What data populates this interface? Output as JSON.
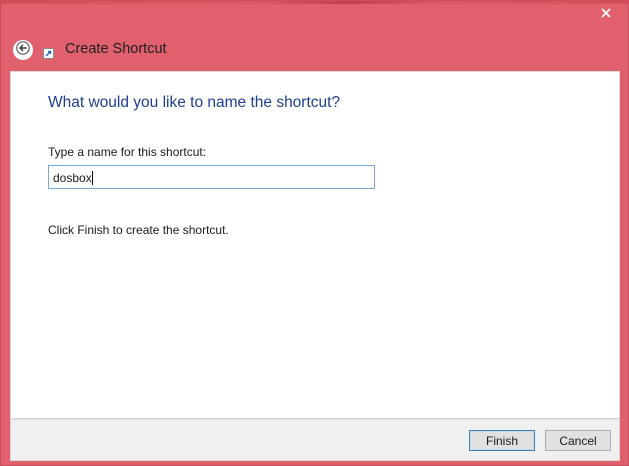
{
  "window": {
    "close_icon": "close-icon",
    "accent_color": "#e0606e"
  },
  "header": {
    "back_icon": "back-arrow-icon",
    "app_icon": "shortcut-icon",
    "title": "Create Shortcut"
  },
  "main": {
    "question": "What would you like to name the shortcut?",
    "field_label": "Type a name for this shortcut:",
    "name_value": "dosbox",
    "hint": "Click Finish to create the shortcut."
  },
  "footer": {
    "finish_label": "Finish",
    "cancel_label": "Cancel"
  }
}
